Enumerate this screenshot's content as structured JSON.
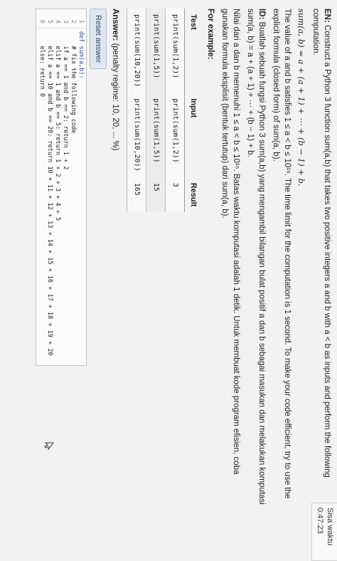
{
  "timer": {
    "label": "Sisa waktu 0:47:23"
  },
  "question": {
    "en_label": "EN:",
    "en_intro": "Construct a Python 3 function sum(a,b) that takes two positive integers a and b with a < b as inputs and perform the following computation.",
    "formula": "sum(a, b) = a + (a + 1) + ⋯ + (b − 1) + b.",
    "en_constraint": "The value of a and b satisfies 1 ≤ a < b ≤ 10¹⁵. The time limit for the computation is 1 second. To make your code efficient, try to use the explicit formula (closed form) of sum(a, b).",
    "id_label": "ID:",
    "id_intro": "Buatlah sebuah fungsi Python 3 sum(a,b) yang mengambil bilangan bulat positif a dan b sebagai masukan dan melakukan komputasi sum(a, b) = a + (a + 1) + ⋯ + (b − 1) + b.",
    "id_constraint": "Nilai dari a dan b memenuhi 1 ≤ a < b ≤ 10¹⁵. Batas waktu komputasi adalah 1 detik. Untuk membuat kode program efisien, coba gunakan formula eksplisit (bentuk tertutup) dari sum(a, b).",
    "for_example": "For example:"
  },
  "examples": {
    "headers": [
      "Test",
      "Input",
      "Result"
    ],
    "rows": [
      {
        "test": "print(sum(1,2))",
        "input": "print(sum(1,2))",
        "result": "3"
      },
      {
        "test": "print(sum(1,5))",
        "input": "print(sum(1,5))",
        "result": "15"
      },
      {
        "test": "print(sum(10,20))",
        "input": "print(sum(10,20))",
        "result": "165"
      }
    ]
  },
  "answer": {
    "label": "Answer:",
    "penalty": "(penalty regime: 10, 20, ... %)"
  },
  "reset_button": "Reset answer",
  "code_lines": [
    {
      "n": "1",
      "text": "def sum(a,b):"
    },
    {
      "n": "2",
      "text": "    # fix the following code"
    },
    {
      "n": "3",
      "text": "    if a == 1 and b == 2: return 1 + 2"
    },
    {
      "n": "4",
      "text": "    elif a == 1 and b == 5: return 1 + 2 + 3 + 4 + 5"
    },
    {
      "n": "5",
      "text": "    elif a == 10 and b == 20: return 10 + 11 + 12 + 13 + 14 + 15 + 16 + 17 + 18 + 19 + 20"
    },
    {
      "n": "6",
      "text": "    else: return 0"
    }
  ]
}
